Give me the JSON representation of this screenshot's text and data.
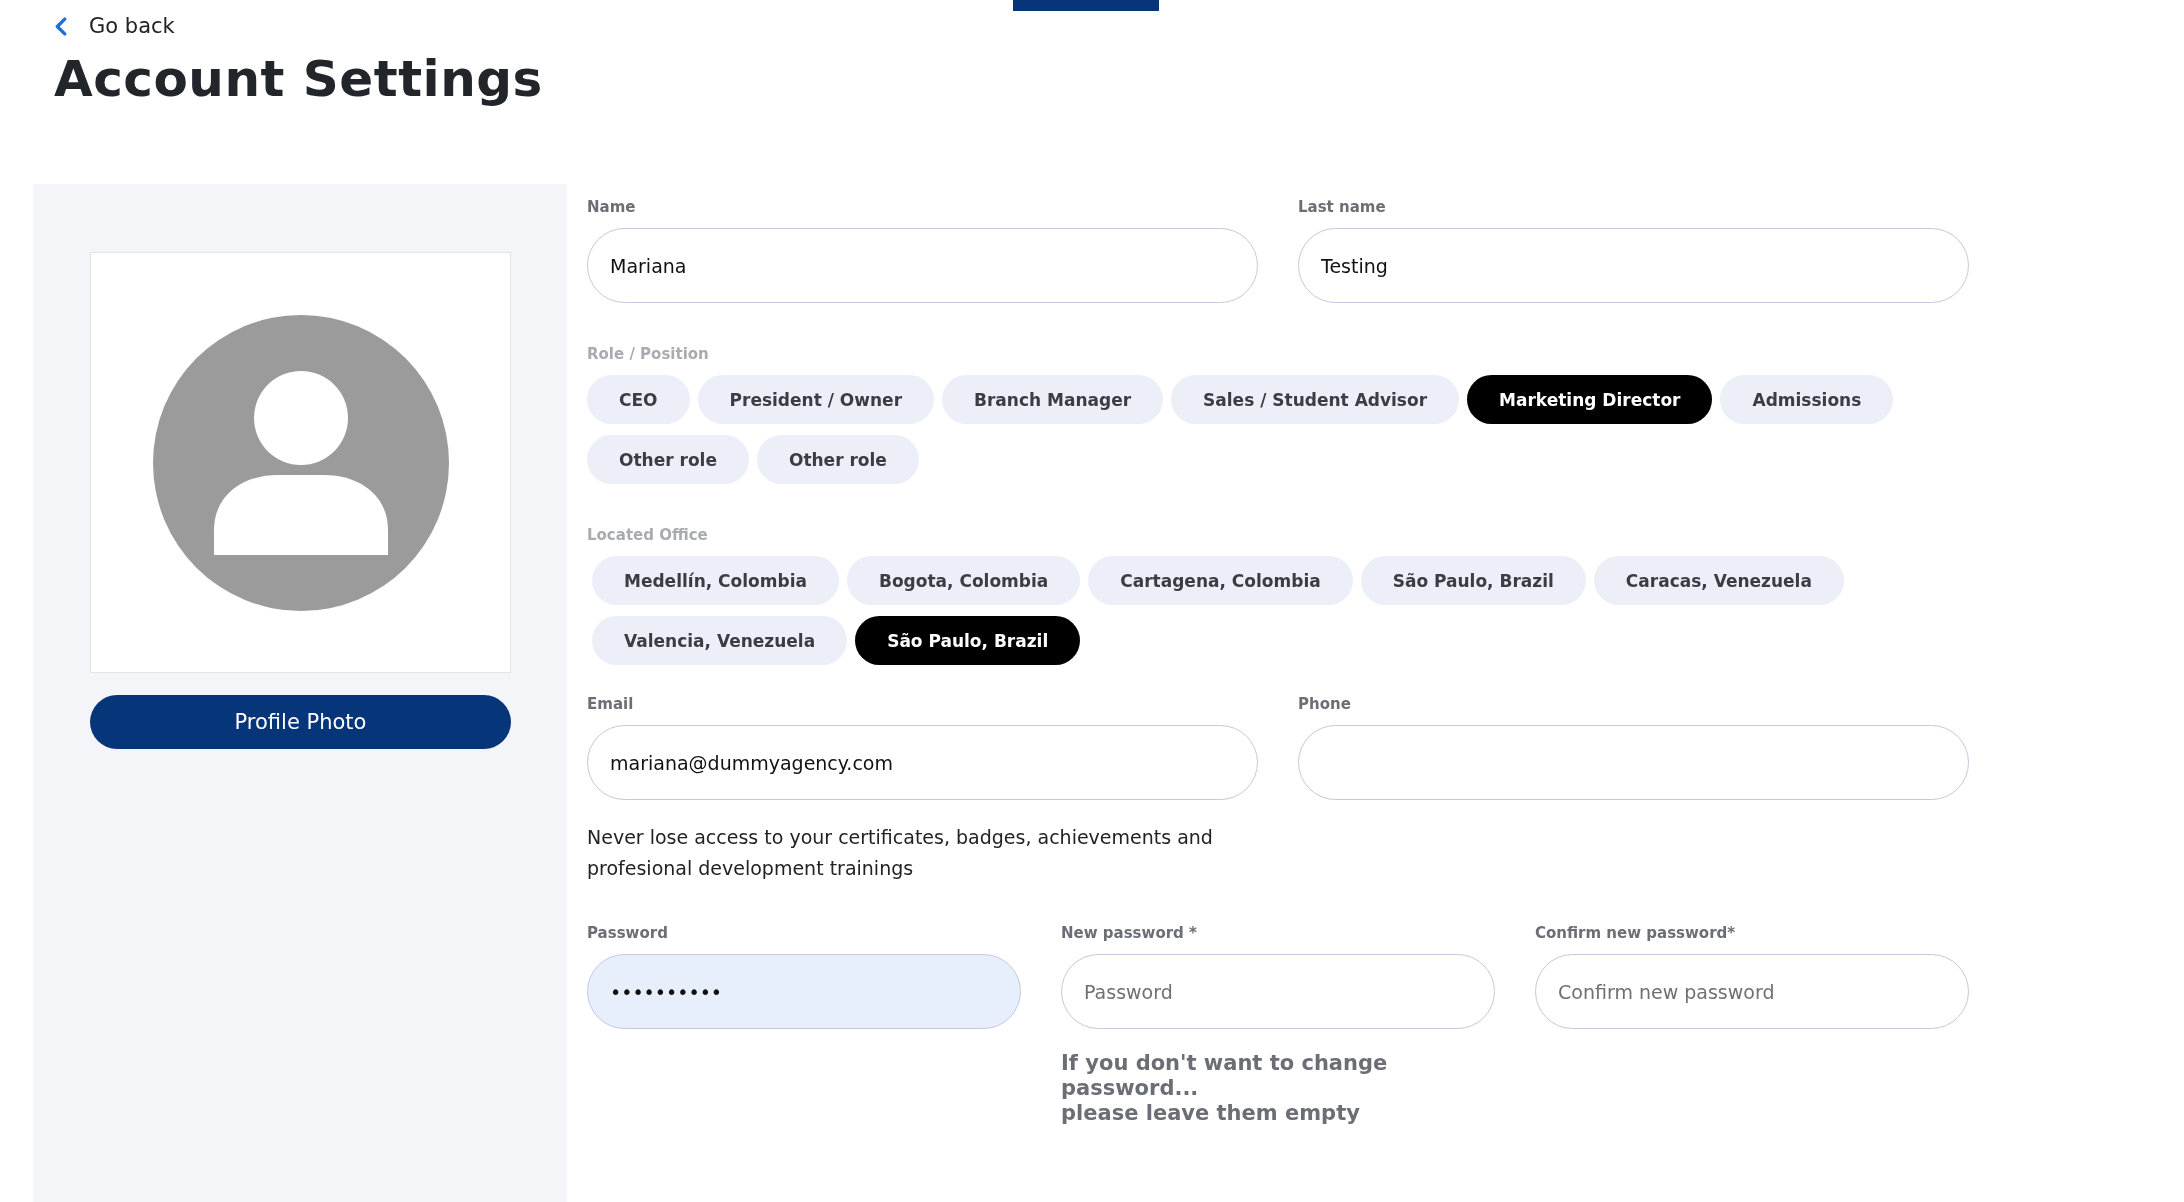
{
  "back_link": {
    "label": "Go back"
  },
  "title": "Account Settings",
  "profile": {
    "photo_button": "Profile Photo"
  },
  "name": {
    "label": "Name",
    "value": "Mariana"
  },
  "last_name": {
    "label": "Last name",
    "value": "Testing"
  },
  "role": {
    "label": "Role / Position",
    "options": [
      {
        "label": "CEO",
        "selected": false
      },
      {
        "label": "President / Owner",
        "selected": false
      },
      {
        "label": "Branch Manager",
        "selected": false
      },
      {
        "label": "Sales / Student Advisor",
        "selected": false
      },
      {
        "label": "Marketing Director",
        "selected": true
      },
      {
        "label": "Admissions",
        "selected": false
      },
      {
        "label": "Other role",
        "selected": false
      },
      {
        "label": "Other role",
        "selected": false
      }
    ]
  },
  "office": {
    "label": "Located Office",
    "options": [
      {
        "label": "Medellín, Colombia",
        "selected": false
      },
      {
        "label": "Bogota, Colombia",
        "selected": false
      },
      {
        "label": "Cartagena, Colombia",
        "selected": false
      },
      {
        "label": "São Paulo, Brazil",
        "selected": false
      },
      {
        "label": "Caracas, Venezuela",
        "selected": false
      },
      {
        "label": "Valencia, Venezuela",
        "selected": false
      },
      {
        "label": "São Paulo, Brazil",
        "selected": true
      }
    ]
  },
  "email": {
    "label": "Email",
    "value": "mariana@dummyagency.com"
  },
  "phone": {
    "label": "Phone"
  },
  "email_note": "Never lose access to your certificates, badges, achievements and profesional development trainings",
  "password": {
    "label": "Password",
    "value": "••••••••••"
  },
  "new_password": {
    "label": "New password *",
    "placeholder": "Password"
  },
  "confirm_password": {
    "label": "Confirm new password*",
    "placeholder": "Confirm new password"
  },
  "password_hint": [
    "If you don't want to change password...",
    "please leave them empty"
  ]
}
